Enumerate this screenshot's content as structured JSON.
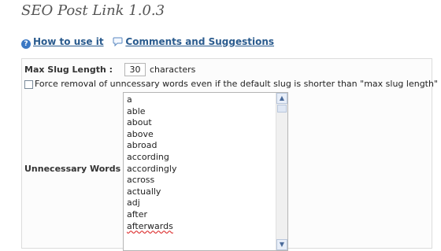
{
  "page": {
    "title": "SEO Post Link 1.0.3"
  },
  "links": {
    "how_to_use": "How to use it",
    "comments": "Comments and Suggestions"
  },
  "settings": {
    "max_slug_label": "Max Slug Length :",
    "max_slug_value": "30",
    "max_slug_unit": "characters",
    "force_removal_label": "Force removal of unncessary words even if the default slug is shorter than \"max slug length\"",
    "force_removal_checked": false,
    "unnecessary_label": "Unnecessary Words :",
    "unnecessary_words": [
      "a",
      "able",
      "about",
      "above",
      "abroad",
      "according",
      "accordingly",
      "across",
      "actually",
      "adj",
      "after",
      "afterwards"
    ]
  },
  "colors": {
    "link": "#2a5b8e",
    "title": "#555555"
  }
}
